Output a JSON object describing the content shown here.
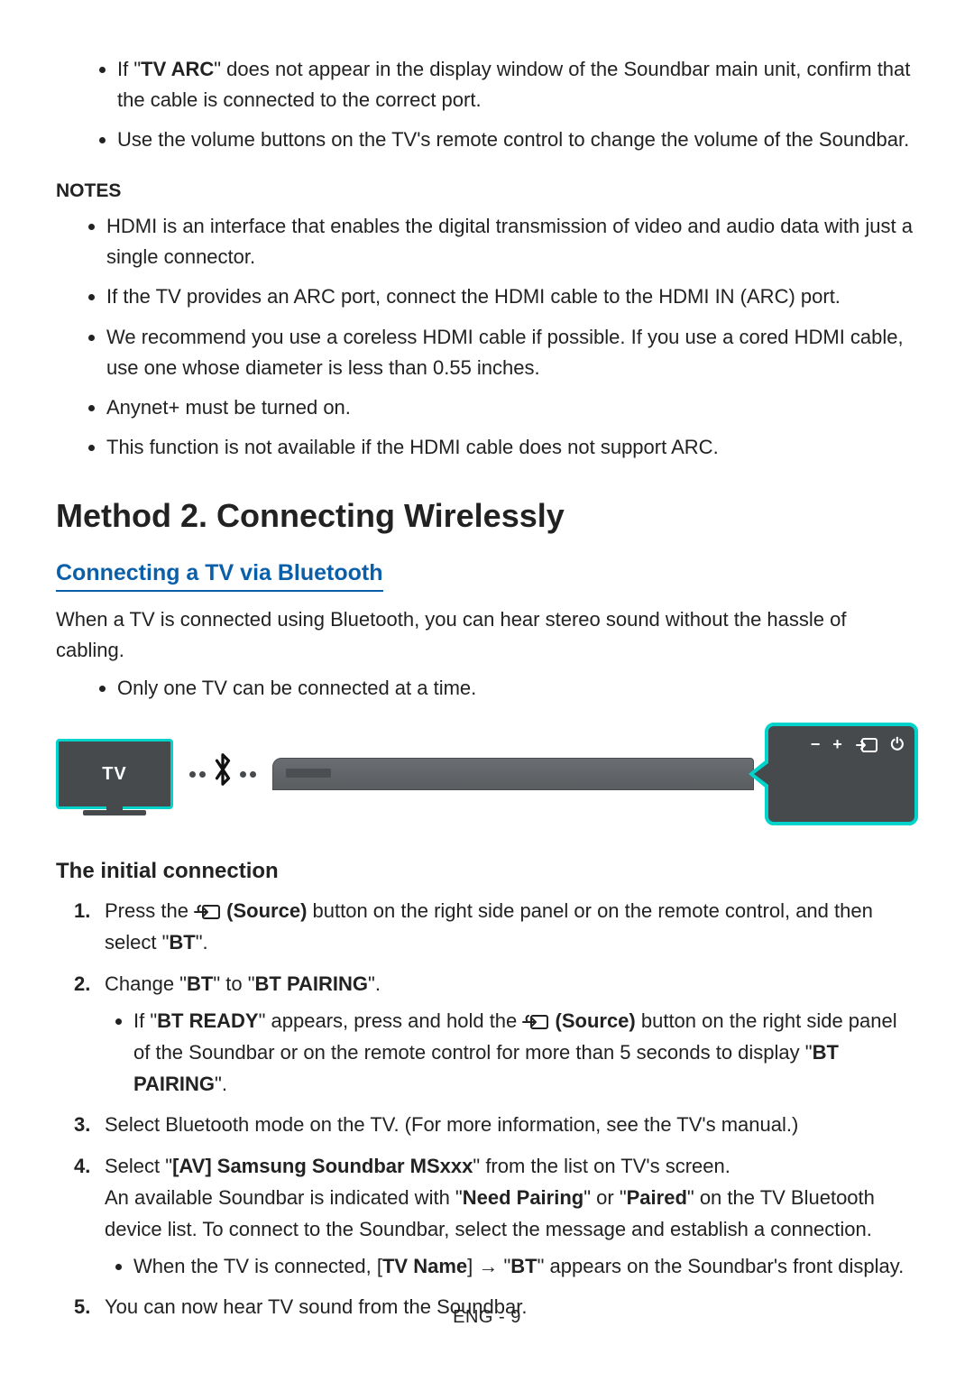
{
  "intro_bullets": [
    {
      "prefix": "If \"",
      "bold": "TV ARC",
      "suffix": "\" does not appear in the display window of the Soundbar main unit, confirm that the cable is connected to the correct port."
    },
    {
      "text": "Use the volume buttons on the TV's remote control to change the volume of the Soundbar."
    }
  ],
  "notes_heading": "NOTES",
  "notes_list": [
    "HDMI is an interface that enables the digital transmission of video and audio data with just a single connector.",
    "If the TV provides an ARC port, connect the HDMI cable to the HDMI IN (ARC) port.",
    "We recommend you use a coreless HDMI cable if possible. If you use a cored HDMI cable, use one whose diameter is less than 0.55 inches.",
    "Anynet+ must be turned on.",
    "This function is not available if the HDMI cable does not support ARC."
  ],
  "method_heading": "Method 2. Connecting Wirelessly",
  "bt_heading": "Connecting a TV via Bluetooth",
  "bt_para": "When a TV is connected using Bluetooth, you can hear stereo sound without the hassle of cabling.",
  "bt_note": "Only one TV can be connected at a time.",
  "diagram": {
    "tv_label": "TV",
    "bluetooth_icon": "bluetooth-icon",
    "controls": {
      "minus": "−",
      "plus": "+",
      "source": "source-icon",
      "power": "⏻"
    }
  },
  "init_heading": "The initial connection",
  "steps": {
    "s1": {
      "num": "1.",
      "pre": "Press the ",
      "source_label": " (Source)",
      "mid": " button on the right side panel or on the remote control, and then select \"",
      "bt": "BT",
      "end": "\"."
    },
    "s2": {
      "num": "2.",
      "pre": "Change \"",
      "bt1": "BT",
      "mid1": "\" to \"",
      "bt2": "BT PAIRING",
      "end": "\".",
      "sub": {
        "pre": "If \"",
        "ready": "BT READY",
        "mid": "\" appears, press and hold the ",
        "source_label": " (Source)",
        "mid2": " button on the right side panel of the Soundbar or on the remote control for more than 5 seconds to display \"",
        "pair": "BT PAIRING",
        "end": "\"."
      }
    },
    "s3": {
      "num": "3.",
      "text": "Select Bluetooth mode on the TV. (For more information, see the TV's manual.)"
    },
    "s4": {
      "num": "4.",
      "pre": "Select \"",
      "av": "[AV] Samsung Soundbar MSxxx",
      "mid": "\" from the list on TV's screen.",
      "line2a": "An available Soundbar is indicated with \"",
      "need": "Need Pairing",
      "line2b": "\" or \"",
      "paired": "Paired",
      "line2c": "\" on the TV Bluetooth device list. To connect to the Soundbar, select the message and establish a connection.",
      "sub": {
        "pre": "When the TV is connected, [",
        "tvname": "TV Name",
        "mid": "] → \"",
        "bt": "BT",
        "end": "\" appears on the Soundbar's front display."
      }
    },
    "s5": {
      "num": "5.",
      "text": "You can now hear TV sound from the Soundbar."
    }
  },
  "footer": "ENG - 9"
}
